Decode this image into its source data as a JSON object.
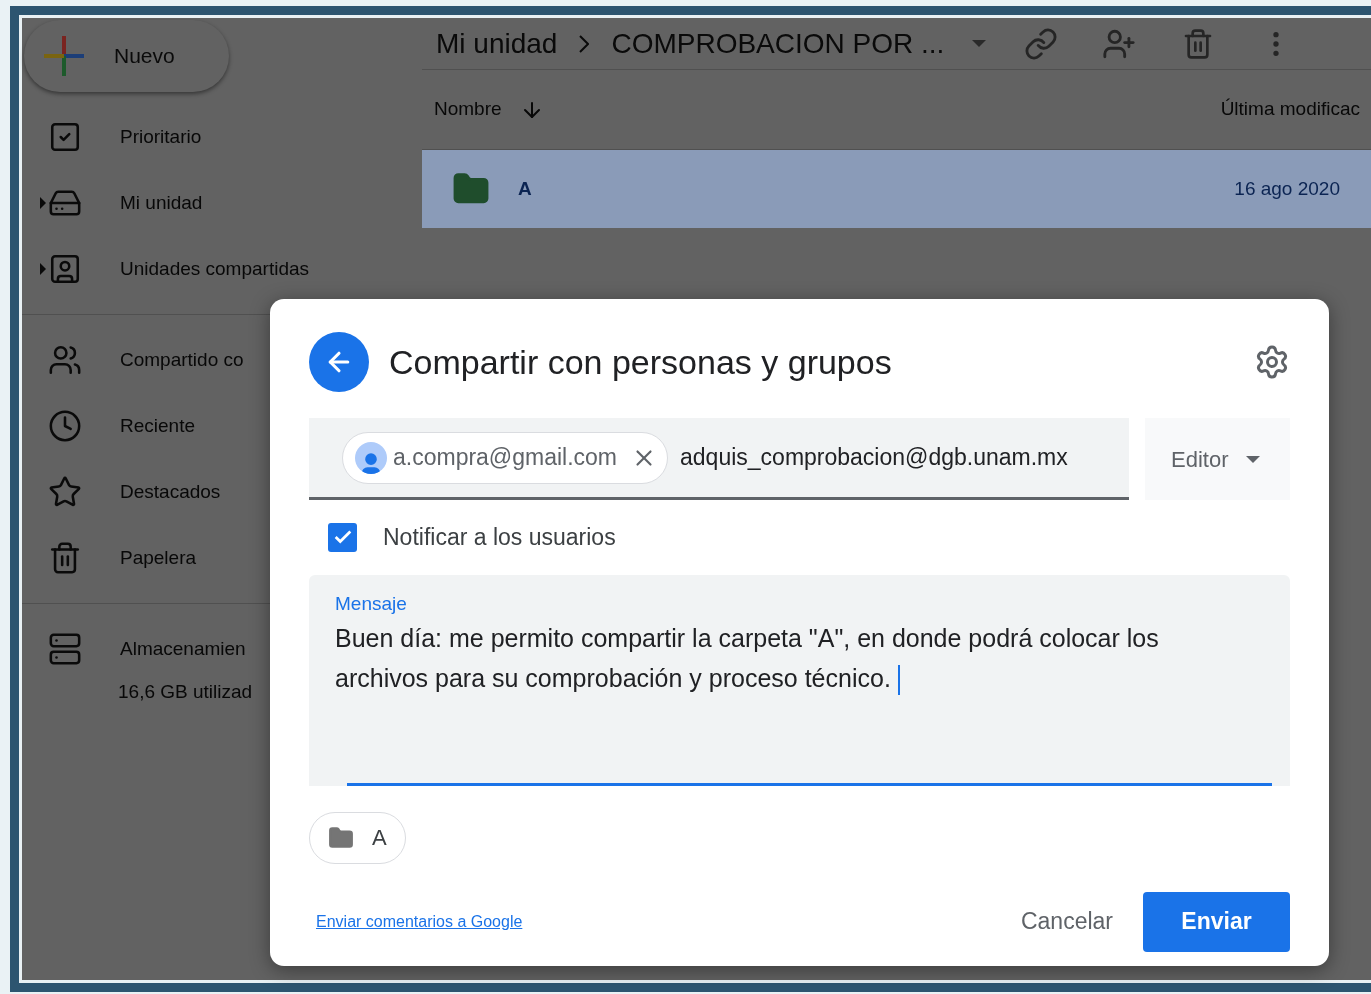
{
  "sidebar": {
    "new_button": "Nuevo",
    "item_groups": [
      [
        {
          "label": "Prioritario",
          "expandable": false
        },
        {
          "label": "Mi unidad",
          "expandable": true
        },
        {
          "label": "Unidades compartidas",
          "expandable": true
        }
      ],
      [
        {
          "label": "Compartido co",
          "expandable": false
        },
        {
          "label": "Reciente",
          "expandable": false
        },
        {
          "label": "Destacados",
          "expandable": false
        },
        {
          "label": "Papelera",
          "expandable": false
        }
      ],
      [
        {
          "label": "Almacenamien",
          "expandable": false
        }
      ]
    ],
    "storage_usage": "16,6 GB utilizad"
  },
  "breadcrumb": [
    "Mi unidad",
    "COMPROBACION POR ..."
  ],
  "file_list": {
    "columns": [
      "Nombre",
      "Última modificac"
    ],
    "rows": [
      {
        "name": "A",
        "modified": "16 ago 2020",
        "selected": true
      }
    ]
  },
  "dialog": {
    "title": "Compartir con personas y grupos",
    "recipients": [
      "a.compra@gmail.com"
    ],
    "input_value": "adquis_comprobacion@dgb.unam.mx",
    "role": "Editor",
    "notify": {
      "label": "Notificar a los usuarios",
      "checked": true
    },
    "message": {
      "label": "Mensaje",
      "value": "Buen día: me permito compartir la carpeta \"A\", en donde podrá colocar los archivos para su comprobación y proceso técnico. "
    },
    "attachment": "A",
    "feedback_link": "Enviar comentarios a Google",
    "cancel": "Cancelar",
    "send": "Enviar"
  }
}
